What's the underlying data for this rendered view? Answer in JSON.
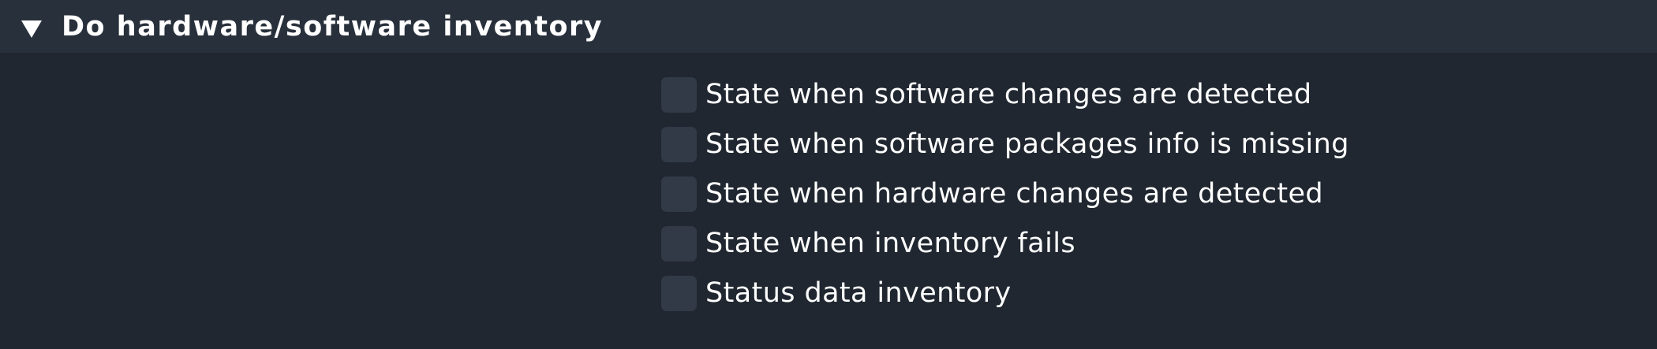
{
  "section": {
    "title": "Do hardware/software inventory",
    "toggle_icon": "triangle-down-icon",
    "expanded": true
  },
  "options": [
    {
      "label": "State when software changes are detected",
      "checked": false
    },
    {
      "label": "State when software packages info is missing",
      "checked": false
    },
    {
      "label": "State when hardware changes are detected",
      "checked": false
    },
    {
      "label": "State when inventory fails",
      "checked": false
    },
    {
      "label": "Status data inventory",
      "checked": false
    }
  ],
  "colors": {
    "background": "#202730",
    "header_background": "#27303b",
    "checkbox_background": "#323a48",
    "text": "#ffffff"
  }
}
